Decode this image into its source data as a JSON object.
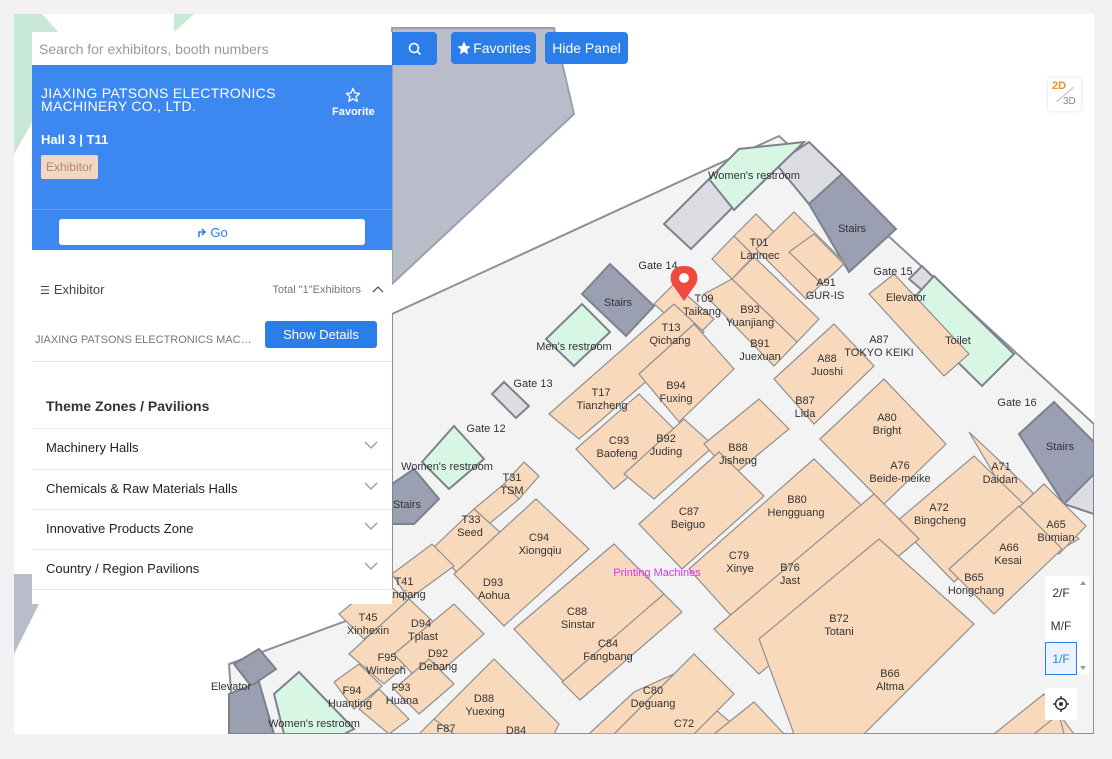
{
  "search": {
    "placeholder": "Search for exhibitors, booth numbers"
  },
  "toolbar": {
    "favorites_label": "Favorites",
    "hide_panel_label": "Hide Panel"
  },
  "exhibitor_card": {
    "company_name": "JIAXING PATSONS ELECTRONICS MACHINERY CO., LTD.",
    "favorite_label": "Favorite",
    "location": "Hall 3 | T11",
    "type_badge": "Exhibitor",
    "go_label": "Go"
  },
  "exhibitor_list": {
    "header": "Exhibitor",
    "total_text": "Total \"1\"Exhibitors",
    "items": [
      {
        "name": "JIAXING PATSONS ELECTRONICS MACHINERY CO., LTD.",
        "action": "Show Details"
      }
    ]
  },
  "zones": {
    "title": "Theme Zones / Pavilions",
    "items": [
      {
        "label": "Machinery Halls"
      },
      {
        "label": "Chemicals & Raw Materials Halls"
      },
      {
        "label": "Innovative Products Zone"
      },
      {
        "label": "Country / Region Pavilions"
      }
    ]
  },
  "view_mode": {
    "primary": "2D",
    "secondary": "3D"
  },
  "floors": {
    "items": [
      "2/F",
      "M/F",
      "1/F"
    ],
    "active": "1/F"
  },
  "map": {
    "zone_label": "Printing Machines",
    "facilities": [
      "Women's restroom",
      "Stairs",
      "Gate 14",
      "Gate 15",
      "Elevator",
      "Toilet",
      "Men's restroom",
      "Gate 13",
      "Gate 12",
      "Women's restroom",
      "Stairs",
      "Gate 16",
      "Stairs",
      "Elevator",
      "Women's restroom"
    ],
    "booths": [
      {
        "code": "T01",
        "name": "Lanmec"
      },
      {
        "code": "T09",
        "name": "Taikang"
      },
      {
        "code": "T13",
        "name": "Qichang"
      },
      {
        "code": "A91",
        "name": "GUR-IS"
      },
      {
        "code": "B93",
        "name": "Yuanjiang"
      },
      {
        "code": "B91",
        "name": "Juexuan"
      },
      {
        "code": "A87",
        "name": "TOKYO KEIKI"
      },
      {
        "code": "A88",
        "name": "Juoshi"
      },
      {
        "code": "T17",
        "name": "Tianzheng"
      },
      {
        "code": "B94",
        "name": "Fuxing"
      },
      {
        "code": "B87",
        "name": "Lida"
      },
      {
        "code": "A80",
        "name": "Bright"
      },
      {
        "code": "C93",
        "name": "Baofeng"
      },
      {
        "code": "B92",
        "name": "Juding"
      },
      {
        "code": "B88",
        "name": "Jisheng"
      },
      {
        "code": "A76",
        "name": "Beide-meike"
      },
      {
        "code": "A71",
        "name": "Daidan"
      },
      {
        "code": "T31",
        "name": "TSM"
      },
      {
        "code": "C87",
        "name": "Beiguo"
      },
      {
        "code": "B80",
        "name": "Hengguang"
      },
      {
        "code": "A72",
        "name": "Bingcheng"
      },
      {
        "code": "A65",
        "name": "Bumian"
      },
      {
        "code": "T33",
        "name": "Seed"
      },
      {
        "code": "C94",
        "name": "Xiongqiu"
      },
      {
        "code": "A66",
        "name": "Kesai"
      },
      {
        "code": "C79",
        "name": "Xinye"
      },
      {
        "code": "B76",
        "name": "Jast"
      },
      {
        "code": "D93",
        "name": "Aohua"
      },
      {
        "code": "B65",
        "name": "Hongchang"
      },
      {
        "code": "T41",
        "name": "anqiang"
      },
      {
        "code": "C88",
        "name": "Sinstar"
      },
      {
        "code": "T45",
        "name": "Xinhexin"
      },
      {
        "code": "D94",
        "name": "Tplast"
      },
      {
        "code": "C84",
        "name": "Fangbang"
      },
      {
        "code": "B72",
        "name": "Totani"
      },
      {
        "code": "F95",
        "name": "Wintech"
      },
      {
        "code": "D92",
        "name": "Debang"
      },
      {
        "code": "B66",
        "name": "Altma"
      },
      {
        "code": "F94",
        "name": "Huanting"
      },
      {
        "code": "F93",
        "name": "Huana"
      },
      {
        "code": "D88",
        "name": "Yuexing"
      },
      {
        "code": "C80",
        "name": "Deguang"
      },
      {
        "code": "F87",
        "name": ""
      },
      {
        "code": "D84",
        "name": ""
      },
      {
        "code": "C72",
        "name": ""
      }
    ]
  },
  "colors": {
    "accent": "#2b7de9",
    "card": "#3c88f0",
    "booth": "#f9d9bc",
    "restroom": "#d7f6e4",
    "stairs": "#9aa0b1",
    "marker": "#f04a3e"
  }
}
